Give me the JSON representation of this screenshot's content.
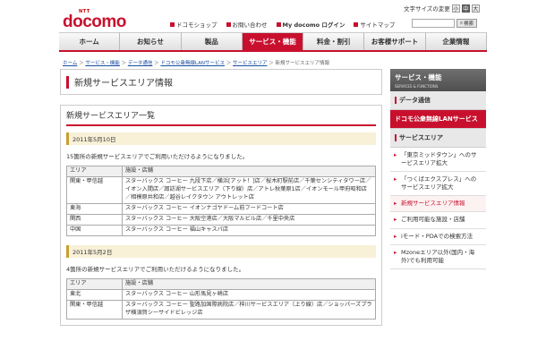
{
  "header": {
    "logo_small": "NTT",
    "logo": "docomo",
    "font_size_label": "文字サイズの変更",
    "font_sizes": [
      "小",
      "中",
      "大"
    ],
    "utils": [
      "ドコモショップ",
      "お問い合わせ",
      "My docomo ログイン",
      "サイトマップ"
    ],
    "search_placeholder": "",
    "search_label": "検索"
  },
  "gnav": [
    "ホーム",
    "お知らせ",
    "製品",
    "サービス・機能",
    "料金・割引",
    "お客様サポート",
    "企業情報"
  ],
  "breadcrumb": [
    "ホーム",
    "サービス・機能",
    "データ通信",
    "ドコモ公衆無線LANサービス",
    "サービスエリア",
    "新規サービスエリア情報"
  ],
  "page_title": "新規サービスエリア情報",
  "section_title": "新規サービスエリア一覧",
  "table_headers": [
    "エリア",
    "施設・店舗"
  ],
  "blocks": [
    {
      "date": "2011年5月10日",
      "note": "15箇所の新規サービスエリアでご利用いただけるようになりました。",
      "rows": [
        {
          "area": "関東・甲信越",
          "stores": "スターバックス コーヒー 九段下店／横浜[アット！]店／桜木町駅前店／千葉センシティタワー店／イオン入間店／諏訪湖サービスエリア（下り線）店／アトレ秋葉原1店／イオンモール甲府昭和店／相模原共和店／越谷レイクタウン アウトレット店"
        },
        {
          "area": "東海",
          "stores": "スターバックス コーヒー イオンナゴヤドーム前フードコート店"
        },
        {
          "area": "関西",
          "stores": "スターバックス コーヒー 大阪空港店／大阪マルビル店／千里中央店"
        },
        {
          "area": "中国",
          "stores": "スターバックス コーヒー 福山キャスパ店"
        }
      ]
    },
    {
      "date": "2011年5月2日",
      "note": "4箇所の新規サービスエリアでご利用いただけるようになりました。",
      "rows": [
        {
          "area": "東北",
          "stores": "スターバックス コーヒー 山形馬見ヶ崎店"
        },
        {
          "area": "関東・甲信越",
          "stores": "スターバックス コーヒー 聖路加国際病院店／梓川サービスエリア（上り線）店／ショッパーズプラザ横須賀シーサイドビレッジ店"
        }
      ]
    }
  ],
  "sidebar": {
    "title": "サービス・機能",
    "subtitle": "SERVICES & FUNCTIONS",
    "items": [
      {
        "label": "データ通信",
        "type": "cat"
      },
      {
        "label": "ドコモ公衆無線LANサービス",
        "type": "cat-hl"
      },
      {
        "label": "サービスエリア",
        "type": "cat"
      },
      {
        "label": "「東京ミッドタウン」へのサービスエリア拡大",
        "type": "sub"
      },
      {
        "label": "「つくばエクスプレス」へのサービスエリア拡大",
        "type": "sub"
      },
      {
        "label": "新規サービスエリア情報",
        "type": "sub-cur"
      },
      {
        "label": "ご利用可能な施設・店舗",
        "type": "sub"
      },
      {
        "label": "iモード・PDAでの検索方法",
        "type": "sub"
      },
      {
        "label": "Mzoneエリア以外(国内・海外)でも利用可能",
        "type": "sub"
      }
    ]
  }
}
